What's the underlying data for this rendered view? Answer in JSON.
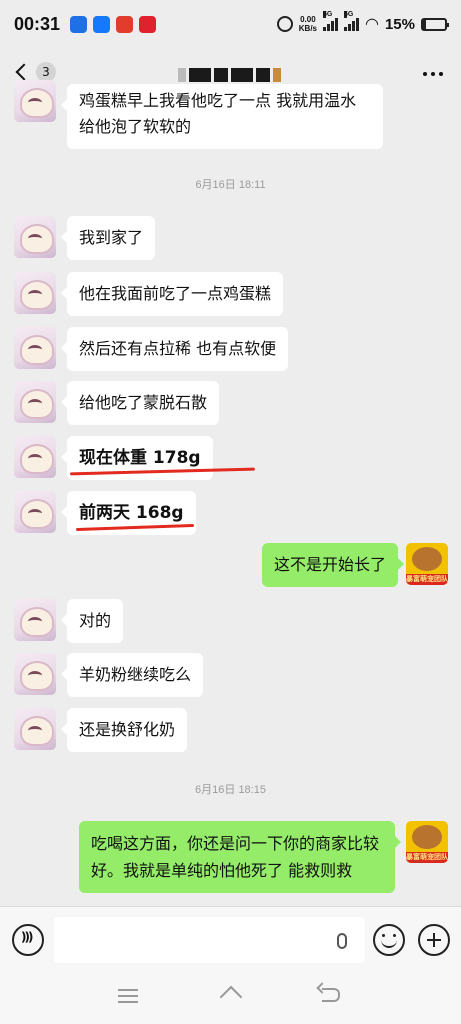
{
  "status_bar": {
    "time": "00:31",
    "net_speed_value": "0.00",
    "net_speed_unit": "KB/s",
    "signal_1_label": "5G",
    "signal_2_label": "5G",
    "battery_percent": "15%",
    "battery_level": 0.15
  },
  "header": {
    "unread_count": "3",
    "title_obscured": true
  },
  "messages": [
    {
      "side": "left",
      "text": "鸡蛋糕早上我看他吃了一点 我就用温水给他泡了软软的",
      "partial": true
    },
    {
      "type": "timestamp",
      "text": "6月16日 18:11"
    },
    {
      "side": "left",
      "text": "我到家了"
    },
    {
      "side": "left",
      "text": "他在我面前吃了一点鸡蛋糕"
    },
    {
      "side": "left",
      "text": "然后还有点拉稀 也有点软便"
    },
    {
      "side": "left",
      "text": "给他吃了蒙脱石散"
    },
    {
      "side": "left",
      "text": "现在体重 178g",
      "underlined": true
    },
    {
      "side": "left",
      "text": "前两天 168g",
      "underlined": true
    },
    {
      "side": "right",
      "text": "这不是开始长了"
    },
    {
      "side": "left",
      "text": "对的"
    },
    {
      "side": "left",
      "text": "羊奶粉继续吃么"
    },
    {
      "side": "left",
      "text": "还是换舒化奶"
    },
    {
      "type": "timestamp",
      "text": "6月16日 18:15"
    },
    {
      "side": "right",
      "text": "吃喝这方面，你还是问一下你的商家比较好。我就是单纯的怕他死了 能救则救"
    }
  ],
  "avatars": {
    "contact": "cat-cartoon-avatar",
    "me": "hamster-photo-avatar",
    "me_band_text": "暴富萌宠团队"
  },
  "colors": {
    "background": "#ededed",
    "bubble_left": "#ffffff",
    "bubble_right": "#95ec69",
    "annotation_red": "#e22a1f"
  },
  "input_bar": {
    "placeholder": ""
  }
}
